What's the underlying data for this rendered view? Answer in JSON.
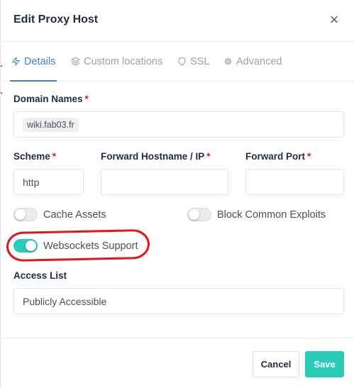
{
  "modal": {
    "title": "Edit Proxy Host",
    "close_glyph": "×"
  },
  "tabs": [
    {
      "label": "Details",
      "icon": "zap-icon",
      "active": true
    },
    {
      "label": "Custom locations",
      "icon": "layers-icon",
      "active": false
    },
    {
      "label": "SSL",
      "icon": "shield-icon",
      "active": false
    },
    {
      "label": "Advanced",
      "icon": "gear-icon",
      "active": false
    }
  ],
  "form": {
    "domain_names": {
      "label": "Domain Names",
      "required_mark": "*",
      "value": "wiki.fab03.fr"
    },
    "scheme": {
      "label": "Scheme",
      "required_mark": "*",
      "value": "http"
    },
    "forward_host": {
      "label": "Forward Hostname / IP",
      "required_mark": "*",
      "value": ""
    },
    "forward_port": {
      "label": "Forward Port",
      "required_mark": "*",
      "value": ""
    },
    "cache_assets": {
      "label": "Cache Assets",
      "enabled": false
    },
    "block_exploits": {
      "label": "Block Common Exploits",
      "enabled": false
    },
    "websockets": {
      "label": "Websockets Support",
      "enabled": true
    },
    "access_list": {
      "label": "Access List",
      "value": "Publicly Accessible"
    }
  },
  "footer": {
    "cancel_label": "Cancel",
    "save_label": "Save"
  },
  "colors": {
    "accent": "#467fcf",
    "toggle_on": "#2bcbba",
    "save_button": "#2bcbba",
    "annotation": "#e0161c",
    "required": "#cd201f"
  }
}
